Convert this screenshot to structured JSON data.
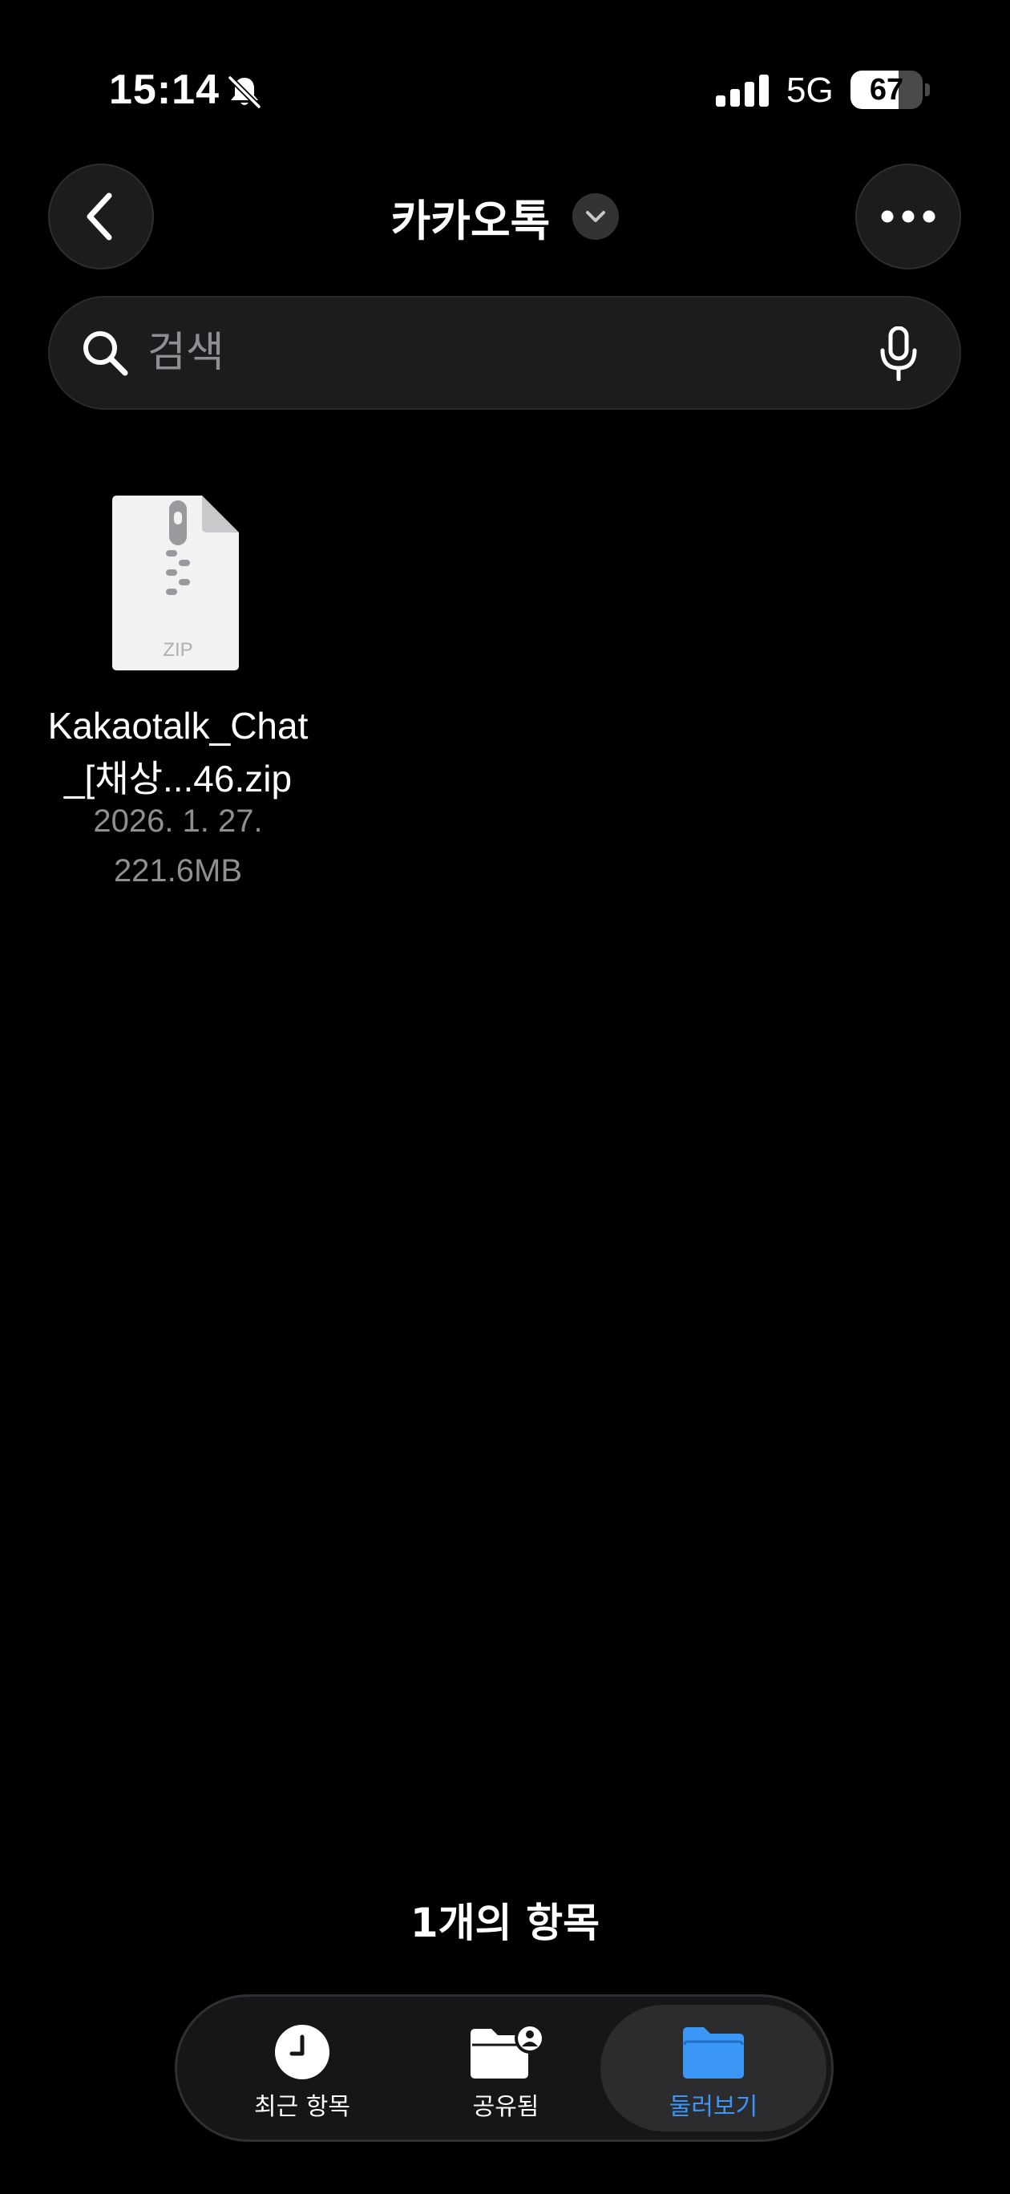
{
  "status_bar": {
    "time": "15:14",
    "network": "5G",
    "battery_percent": "67",
    "battery_level": 0.67,
    "icons": [
      "bell-slash-icon",
      "cellular-signal-icon",
      "battery-icon"
    ]
  },
  "nav": {
    "title": "카카오톡",
    "back_icon": "chevron-left-icon",
    "title_menu_icon": "chevron-down-icon",
    "more_icon": "ellipsis-icon"
  },
  "search": {
    "placeholder": "검색",
    "value": "",
    "icons": [
      "magnifying-glass-icon",
      "microphone-icon"
    ]
  },
  "files": [
    {
      "name": "Kakaotalk_Chat_[채상...46.zip",
      "name_line1": "Kakaotalk_Chat",
      "name_line2": "_[채상...46.zip",
      "date": "2026. 1. 27.",
      "size": "221.6MB",
      "type_label": "ZIP",
      "icon": "zip-file-icon"
    }
  ],
  "item_count": "1개의 항목",
  "tabs": [
    {
      "label": "최근 항목",
      "icon": "clock-icon",
      "selected": false
    },
    {
      "label": "공유됨",
      "icon": "shared-folder-icon",
      "selected": false
    },
    {
      "label": "둘러보기",
      "icon": "folder-icon",
      "selected": true
    }
  ],
  "colors": {
    "background": "#000000",
    "surface": "#1c1c1e",
    "accent": "#3b97f6",
    "secondary_text": "#8e8e93"
  }
}
